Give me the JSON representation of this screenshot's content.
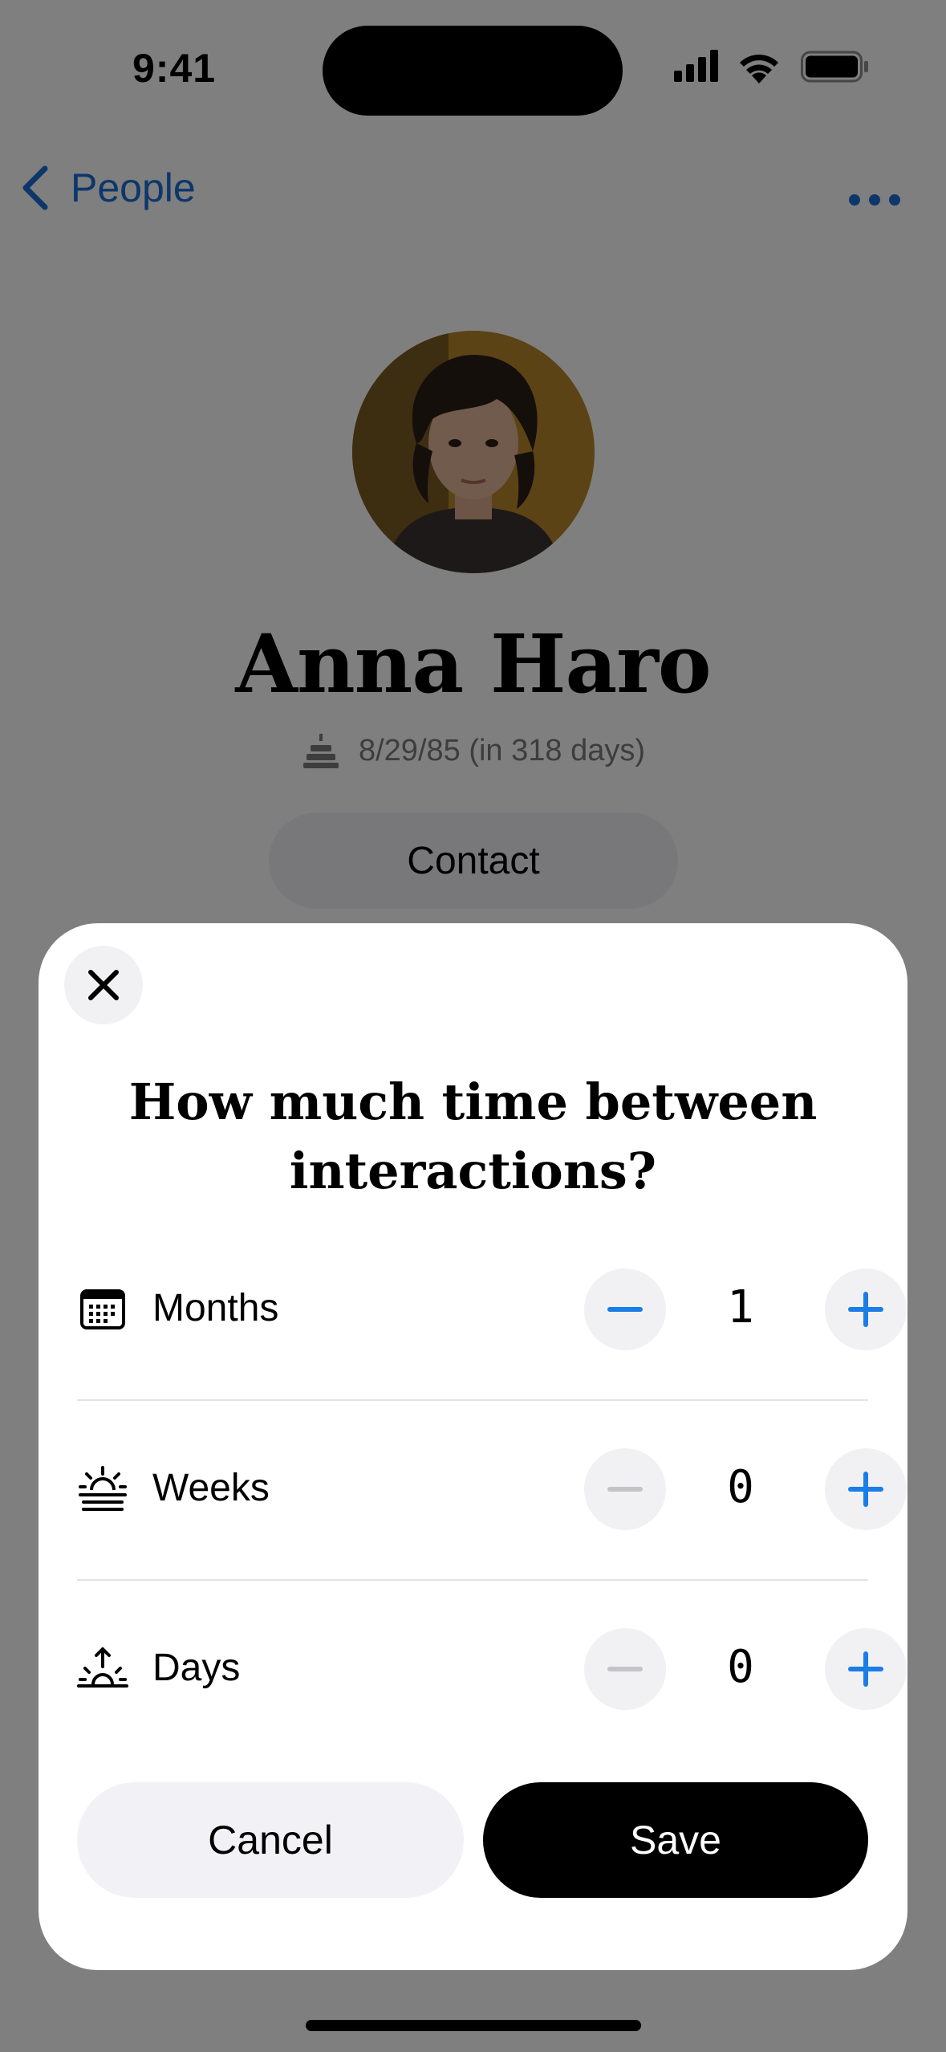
{
  "status_bar": {
    "time": "9:41",
    "icons": [
      "signal-icon",
      "wifi-icon",
      "battery-icon"
    ]
  },
  "nav": {
    "back_label": "People",
    "back_icon": "chevron-left-icon",
    "more_icon": "ellipsis-icon",
    "accent_color": "#1a6fd6"
  },
  "person": {
    "name": "Anna Haro",
    "birthday": "8/29/85 (in 318 days)",
    "birthday_icon": "birthday-cake-icon",
    "contact_label": "Contact"
  },
  "sheet": {
    "close_icon": "close-icon",
    "title": "How much time between interactions?",
    "rows": [
      {
        "label": "Months",
        "icon": "calendar-icon",
        "value": "1",
        "minus_enabled": true
      },
      {
        "label": "Weeks",
        "icon": "sunrise-icon",
        "value": "0",
        "minus_enabled": false
      },
      {
        "label": "Days",
        "icon": "sun-up-icon",
        "value": "0",
        "minus_enabled": false
      }
    ],
    "cancel_label": "Cancel",
    "save_label": "Save",
    "stepper_accent": "#1a7ee6",
    "stepper_disabled": "#c4c4c8"
  }
}
